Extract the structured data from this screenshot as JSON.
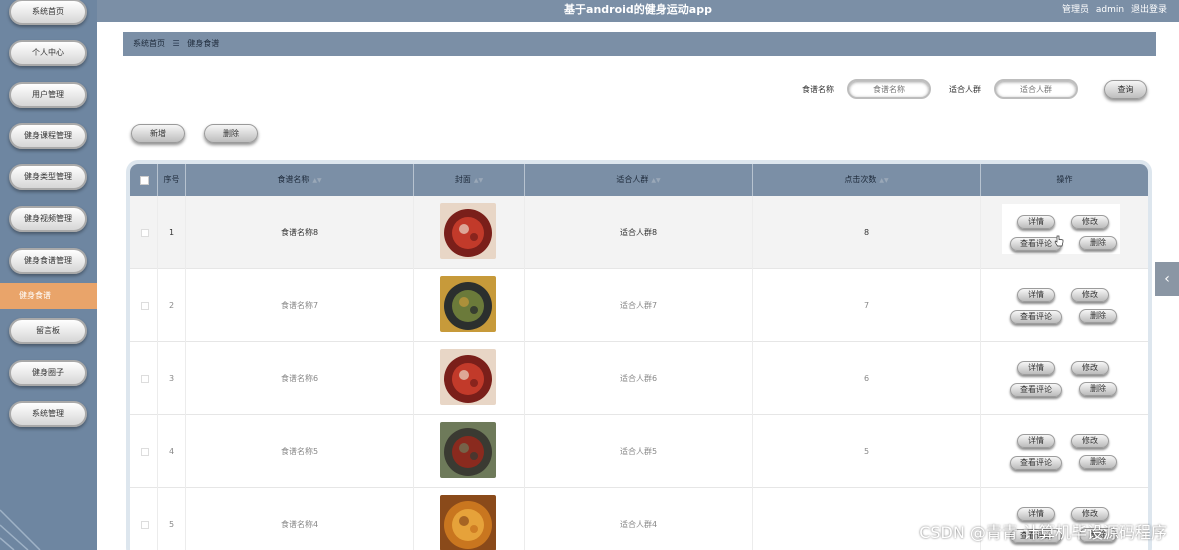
{
  "header": {
    "title": "基于android的健身运动app",
    "user_role": "管理员",
    "username": "admin",
    "logout": "退出登录"
  },
  "sidebar": {
    "items": [
      {
        "label": "系统首页"
      },
      {
        "label": "个人中心"
      },
      {
        "label": "用户管理"
      },
      {
        "label": "健身课程管理"
      },
      {
        "label": "健身类型管理"
      },
      {
        "label": "健身视频管理"
      },
      {
        "label": "健身食谱管理"
      },
      {
        "label": "健身食谱"
      },
      {
        "label": "留言板"
      },
      {
        "label": "健身圈子"
      },
      {
        "label": "系统管理"
      }
    ],
    "active_index": 7
  },
  "breadcrumb": {
    "home": "系统首页",
    "current": "健身食谱"
  },
  "search": {
    "name_label": "食谱名称",
    "name_placeholder": "食谱名称",
    "crowd_label": "适合人群",
    "crowd_placeholder": "适合人群",
    "query_button": "查询"
  },
  "toolbar": {
    "add": "新增",
    "delete": "删除"
  },
  "table": {
    "columns": [
      "序号",
      "食谱名称",
      "封面",
      "适合人群",
      "点击次数",
      "操作"
    ],
    "rows": [
      {
        "index": "1",
        "name": "食谱名称8",
        "crowd": "适合人群8",
        "clicks": "8",
        "colors": [
          "#7a1f1a",
          "#c23a2a",
          "#e8d6c6"
        ]
      },
      {
        "index": "2",
        "name": "食谱名称7",
        "crowd": "适合人群7",
        "clicks": "7",
        "colors": [
          "#2b2f2e",
          "#6b7a3a",
          "#c79a3a"
        ]
      },
      {
        "index": "3",
        "name": "食谱名称6",
        "crowd": "适合人群6",
        "clicks": "6",
        "colors": [
          "#7a1f1a",
          "#c23a2a",
          "#e8d6c6"
        ]
      },
      {
        "index": "4",
        "name": "食谱名称5",
        "crowd": "适合人群5",
        "clicks": "5",
        "colors": [
          "#3a3a32",
          "#8a2a1e",
          "#6e7a5a"
        ]
      },
      {
        "index": "5",
        "name": "食谱名称4",
        "crowd": "适合人群4",
        "clicks": "",
        "colors": [
          "#c9761f",
          "#e6a23a",
          "#8a4a1a"
        ]
      }
    ],
    "actions": {
      "detail": "详情",
      "edit": "修改",
      "comments": "查看评论",
      "delete": "删除"
    }
  },
  "colors": {
    "header_bg": "#7b8fa6",
    "sidebar_bg": "#6e86a1",
    "active_item": "#e9a46a"
  },
  "watermark": "CSDN @青青 计算机毕设源码程序",
  "icons": {
    "collapse": "chevron-left-icon",
    "sort": "sort-icon"
  }
}
